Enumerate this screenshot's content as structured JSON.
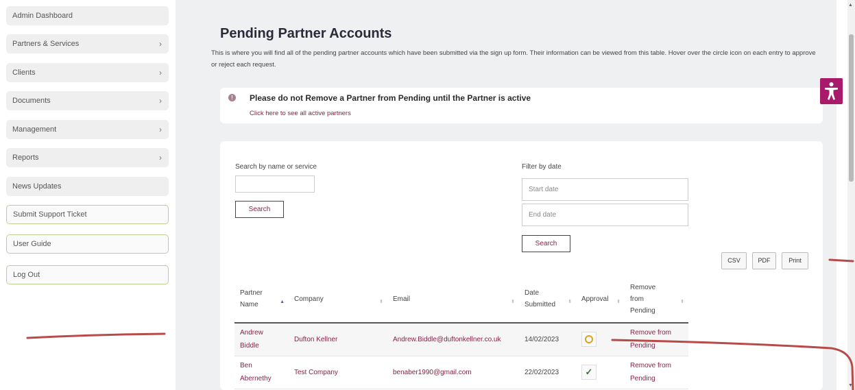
{
  "sidebar": {
    "items": [
      {
        "label": "Admin Dashboard"
      },
      {
        "label": "Partners & Services",
        "chev": "›"
      },
      {
        "label": "Clients",
        "chev": "›"
      },
      {
        "label": "Documents",
        "chev": "›"
      },
      {
        "label": "Management",
        "chev": "›"
      },
      {
        "label": "Reports",
        "chev": "›"
      },
      {
        "label": "News Updates"
      },
      {
        "label": "Submit Support Ticket"
      },
      {
        "label": "User Guide"
      },
      {
        "label": "Log Out"
      }
    ]
  },
  "page": {
    "title": "Pending Partner Accounts",
    "description": "This is where you will find all of the pending partner accounts which have been submitted via the sign up form. Their information can be viewed from this table. Hover over the circle icon on each entry to approve or reject each request."
  },
  "notice": {
    "icon": "info-icon",
    "message": "Please do not Remove a Partner from Pending until the Partner is active",
    "link": "Click here to see all active partners"
  },
  "search": {
    "label": "Search by name or service",
    "value": "",
    "button": "Search"
  },
  "filter": {
    "label": "Filter by date",
    "start_placeholder": "Start date",
    "end_placeholder": "End date",
    "button": "Search"
  },
  "export": {
    "csv": "CSV",
    "pdf": "PDF",
    "print": "Print"
  },
  "table": {
    "headers": {
      "partner_name": "Partner Name",
      "company": "Company",
      "email": "Email",
      "date_submitted": "Date Submitted",
      "approval": "Approval",
      "remove": "Remove from Pending"
    },
    "rows": [
      {
        "partner_name": "Andrew Biddle",
        "company": "Dufton Kellner",
        "email": "Andrew.Biddle@duftonkellner.co.uk",
        "date": "14/02/2023",
        "approval": "pending",
        "remove": "Remove from Pending"
      },
      {
        "partner_name": "Ben Abernethy",
        "company": "Test Company",
        "email": "benaber1990@gmail.com",
        "date": "22/02/2023",
        "approval": "approved",
        "remove": "Remove from Pending"
      }
    ]
  },
  "colors": {
    "accent": "#8a1f4a",
    "accessibility": "#a81a6a",
    "annotation": "#b84a4a",
    "pending": "#e0a01a",
    "approved": "#2b7a2b"
  }
}
